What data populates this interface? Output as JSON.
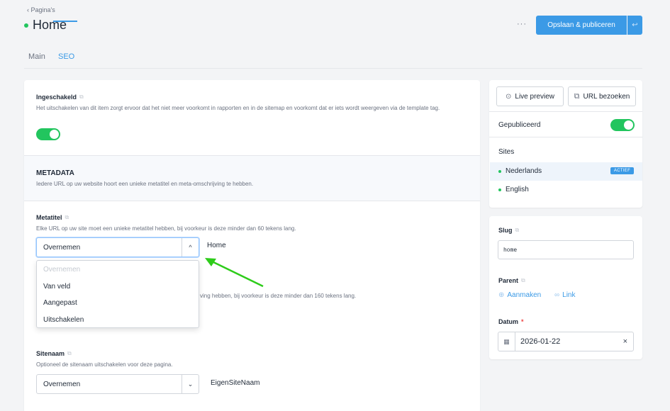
{
  "header": {
    "breadcrumb": "‹ Pagina's",
    "title": "Home",
    "more": "···",
    "publish_label": "Opslaan & publiceren",
    "publish_split_icon": "↩"
  },
  "tabs": [
    {
      "label": "Main",
      "active": false
    },
    {
      "label": "SEO",
      "active": true
    }
  ],
  "main": {
    "enabled": {
      "label": "Ingeschakeld",
      "help": "Het uitschakelen van dit item zorgt ervoor dat het niet meer voorkomt in rapporten en in de sitemap en voorkomt dat er iets wordt weergeven via de template tag.",
      "on": true
    },
    "metadata": {
      "title": "METADATA",
      "help": "Iedere URL op uw website hoort een unieke metatitel en meta-omschrijving te hebben."
    },
    "metatitle": {
      "label": "Metatitel",
      "help": "Elke URL op uw site moet een unieke metatitel hebben, bij voorkeur is deze minder dan 60 tekens lang.",
      "selected": "Overnemen",
      "value_beside": "Home",
      "chevron": "^",
      "options": [
        "Overnemen",
        "Van veld",
        "Aangepast",
        "Uitschakelen"
      ]
    },
    "metadesc": {
      "help_partial": "ving hebben, bij voorkeur is deze minder dan 160 tekens lang."
    },
    "sitename": {
      "label": "Sitenaam",
      "help": "Optioneel de sitenaam uitschakelen voor deze pagina.",
      "selected": "Overnemen",
      "value_beside": "EigenSiteNaam",
      "chevron": "⌄"
    }
  },
  "sidebar": {
    "live_preview": "Live preview",
    "visit_url": "URL bezoeken",
    "published_label": "Gepubliceerd",
    "published_on": true,
    "sites_title": "Sites",
    "sites": [
      {
        "name": "Nederlands",
        "badge": "ACTIEF"
      },
      {
        "name": "English",
        "badge": ""
      }
    ],
    "slug_label": "Slug",
    "slug_value": "home",
    "parent_label": "Parent",
    "parent_create": "Aanmaken",
    "parent_link": "Link",
    "date_label": "Datum",
    "date_required": "*",
    "date_value": "2026-01-22",
    "date_clear": "×"
  },
  "colors": {
    "accent": "#3b9ae6",
    "success": "#22c55e",
    "annotation_arrow": "#2ecc1a"
  },
  "icons": [
    "translate-icon",
    "eye-icon",
    "external-link-icon",
    "calendar-icon",
    "add-icon",
    "link-icon",
    "chevron-up-icon",
    "chevron-down-icon",
    "return-icon",
    "clear-icon"
  ]
}
